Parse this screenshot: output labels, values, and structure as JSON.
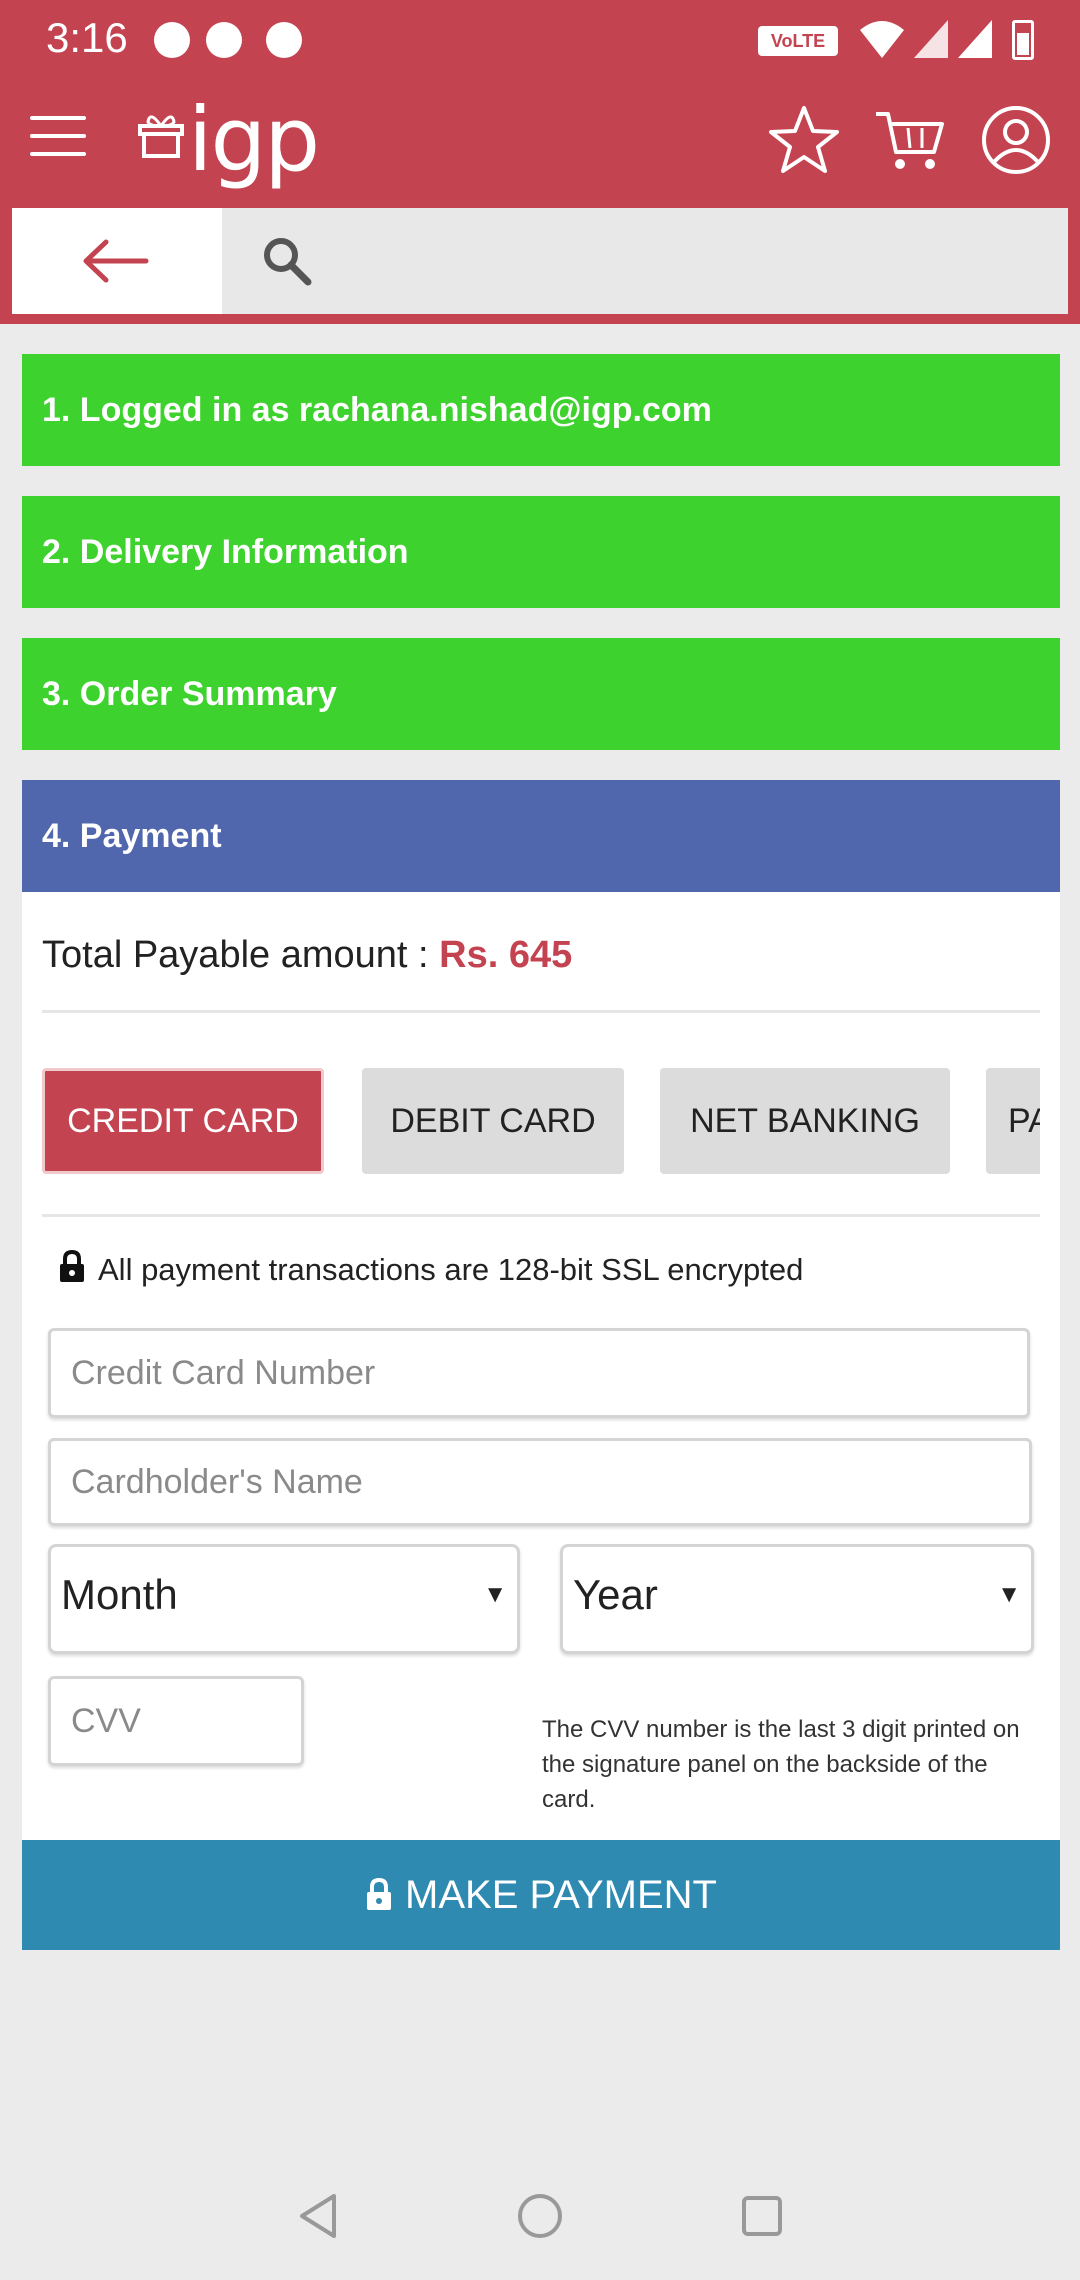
{
  "status_bar": {
    "time": "3:16",
    "network_badge": "VoLTE",
    "icons": [
      "chat-bubble-icon",
      "message-icon",
      "pinterest-icon",
      "wifi-icon",
      "signal-icon",
      "signal-icon",
      "battery-icon"
    ]
  },
  "app_bar": {
    "logo": "igp",
    "icons": [
      "menu-icon",
      "star-icon",
      "cart-icon",
      "account-icon"
    ]
  },
  "search": {
    "back_icon": "arrow-left-icon",
    "icon": "search-icon",
    "placeholder": ""
  },
  "steps": [
    {
      "label": "1. Logged in as rachana.nishad@igp.com"
    },
    {
      "label": "2. Delivery Information"
    },
    {
      "label": "3. Order Summary"
    },
    {
      "label": "4. Payment"
    }
  ],
  "payment": {
    "total_label": "Total Payable amount : ",
    "total_amount": "Rs. 645",
    "tabs": [
      {
        "label": "CREDIT CARD",
        "selected": true
      },
      {
        "label": "DEBIT CARD",
        "selected": false
      },
      {
        "label": "NET BANKING",
        "selected": false
      },
      {
        "label": "PA",
        "selected": false
      }
    ],
    "secure_note": "All payment transactions are 128-bit SSL encrypted",
    "card_number_placeholder": "Credit Card Number",
    "cardholder_placeholder": "Cardholder's Name",
    "month_label": "Month",
    "year_label": "Year",
    "cvv_placeholder": "CVV",
    "cvv_note": "The CVV number is the last 3 digit printed on the signature panel on the backside of the card.",
    "pay_button": "MAKE PAYMENT"
  },
  "colors": {
    "brand": "#c44350",
    "step_done": "#3dd22d",
    "step_active": "#5067ae",
    "pay_button": "#2e8ab0"
  },
  "nav": [
    "back-triangle-icon",
    "home-circle-icon",
    "recents-square-icon"
  ]
}
